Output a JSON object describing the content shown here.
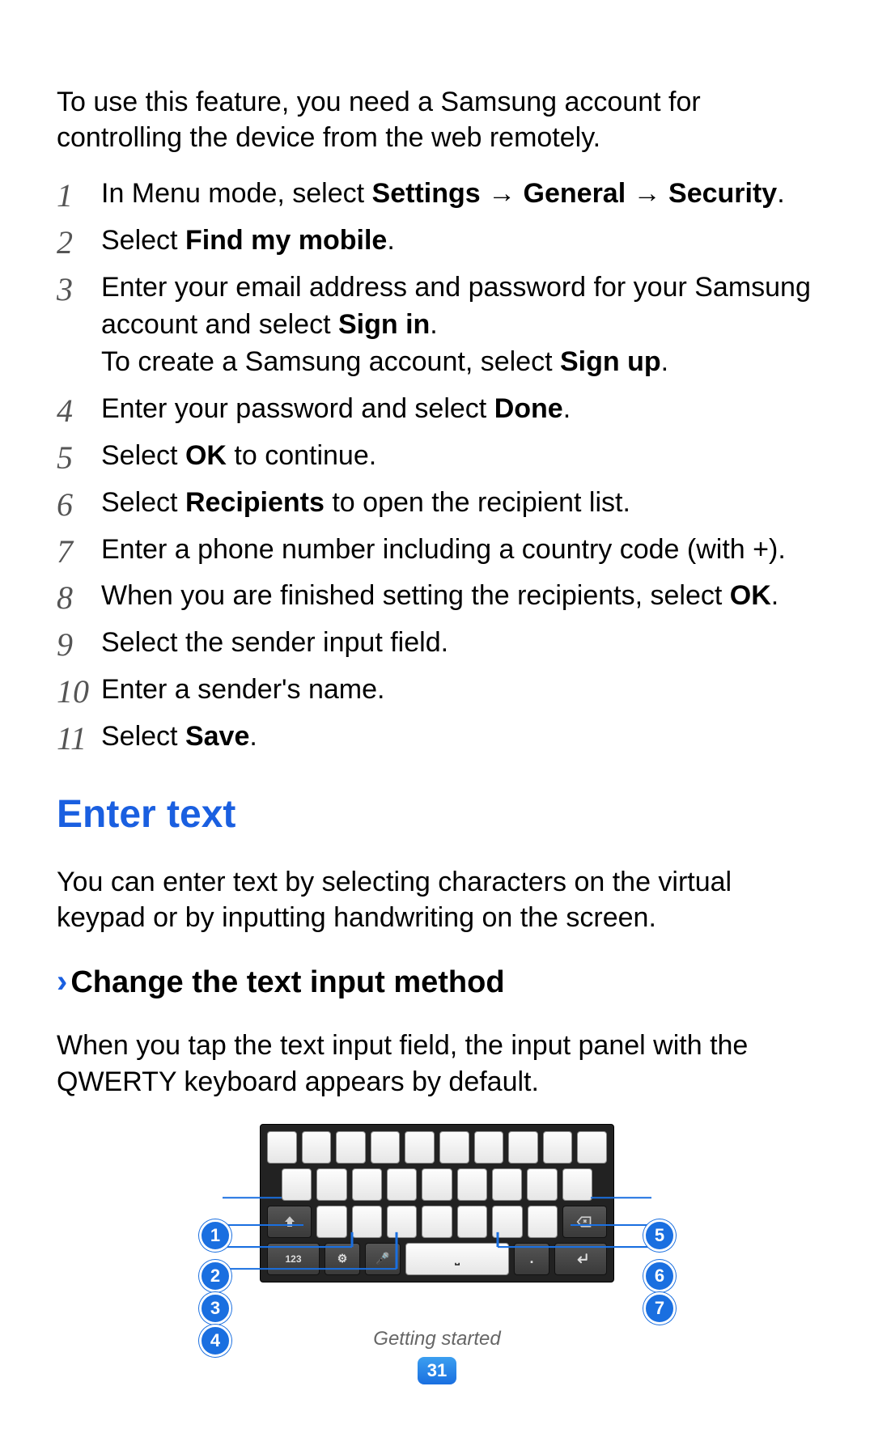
{
  "intro": "To use this feature, you need a Samsung account for controlling the device from the web remotely.",
  "steps": [
    {
      "n": "1",
      "pre": "In Menu mode, select ",
      "bold": "Settings → General → Security",
      "post": "."
    },
    {
      "n": "2",
      "pre": "Select ",
      "bold": "Find my mobile",
      "post": "."
    },
    {
      "n": "3",
      "pre": "Enter your email address and password for your Samsung account and select ",
      "bold": "Sign in",
      "post": ".",
      "extraPre": "To create a Samsung account, select ",
      "extraBold": "Sign up",
      "extraPost": "."
    },
    {
      "n": "4",
      "pre": "Enter your password and select ",
      "bold": "Done",
      "post": "."
    },
    {
      "n": "5",
      "pre": "Select ",
      "bold": "OK",
      "post": " to continue."
    },
    {
      "n": "6",
      "pre": "Select ",
      "bold": "Recipients",
      "post": " to open the recipient list."
    },
    {
      "n": "7",
      "pre": "Enter a phone number including a country code (with +).",
      "bold": "",
      "post": ""
    },
    {
      "n": "8",
      "pre": "When you are finished setting the recipients, select ",
      "bold": "OK",
      "post": "."
    },
    {
      "n": "9",
      "pre": "Select the sender input field.",
      "bold": "",
      "post": ""
    },
    {
      "n": "10",
      "pre": "Enter a sender's name.",
      "bold": "",
      "post": ""
    },
    {
      "n": "11",
      "pre": "Select ",
      "bold": "Save",
      "post": "."
    }
  ],
  "section": {
    "title": "Enter text",
    "body": "You can enter text by selecting characters on the virtual keypad or by inputting handwriting on the screen."
  },
  "subsection": {
    "chevron": "›",
    "title": "Change the text input method",
    "body": "When you tap the text input field, the input panel with the QWERTY keyboard appears by default."
  },
  "keyboard": {
    "row4": {
      "num_label": "123",
      "period": "."
    },
    "callouts": [
      "1",
      "2",
      "3",
      "4",
      "5",
      "6",
      "7"
    ]
  },
  "footer": {
    "section": "Getting started",
    "page": "31"
  }
}
